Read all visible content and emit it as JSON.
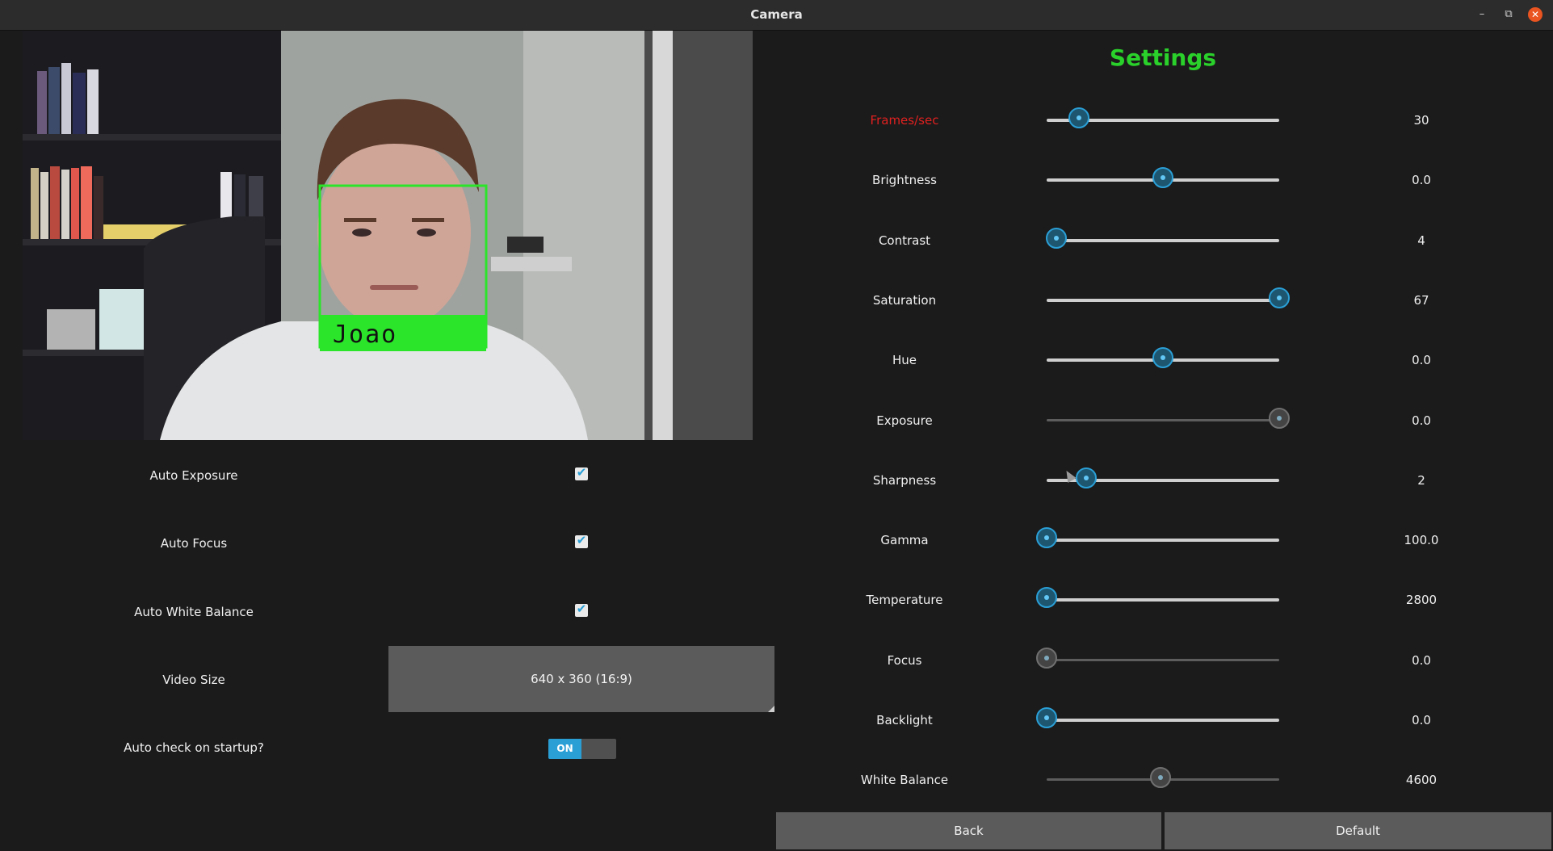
{
  "window": {
    "title": "Camera",
    "minimize_icon": "minimize-icon",
    "maximize_icon": "restore-icon",
    "close_icon": "close-icon"
  },
  "camera": {
    "detected_name": "Joao",
    "box_color": "#2be52b"
  },
  "left_settings": {
    "auto_exposure": {
      "label": "Auto Exposure",
      "checked": true
    },
    "auto_focus": {
      "label": "Auto Focus",
      "checked": true
    },
    "auto_white_balance": {
      "label": "Auto White Balance",
      "checked": true
    },
    "video_size": {
      "label": "Video Size",
      "value": "640 x 360 (16:9)"
    },
    "auto_check": {
      "label": "Auto check on startup?",
      "toggle_text": "ON"
    }
  },
  "settings": {
    "title": "Settings",
    "sliders": [
      {
        "label": "Frames/sec",
        "value": "30",
        "fraction": 0.14,
        "highlight": true
      },
      {
        "label": "Brightness",
        "value": "0.0",
        "fraction": 0.5
      },
      {
        "label": "Contrast",
        "value": "4",
        "fraction": 0.04
      },
      {
        "label": "Saturation",
        "value": "67",
        "fraction": 1.0
      },
      {
        "label": "Hue",
        "value": "0.0",
        "fraction": 0.5
      },
      {
        "label": "Exposure",
        "value": "0.0",
        "fraction": 1.0,
        "disabled": true
      },
      {
        "label": "Sharpness",
        "value": "2",
        "fraction": 0.17
      },
      {
        "label": "Gamma",
        "value": "100.0",
        "fraction": 0.0
      },
      {
        "label": "Temperature",
        "value": "2800",
        "fraction": 0.0
      },
      {
        "label": "Focus",
        "value": "0.0",
        "fraction": 0.0,
        "disabled": true
      },
      {
        "label": "Backlight",
        "value": "0.0",
        "fraction": 0.0
      },
      {
        "label": "White Balance",
        "value": "4600",
        "fraction": 0.49,
        "disabled": true
      }
    ]
  },
  "buttons": {
    "back": "Back",
    "default": "Default"
  },
  "colors": {
    "accent": "#2a9fd6",
    "settings_title": "#2ad12a",
    "highlight_label": "#e02020"
  }
}
